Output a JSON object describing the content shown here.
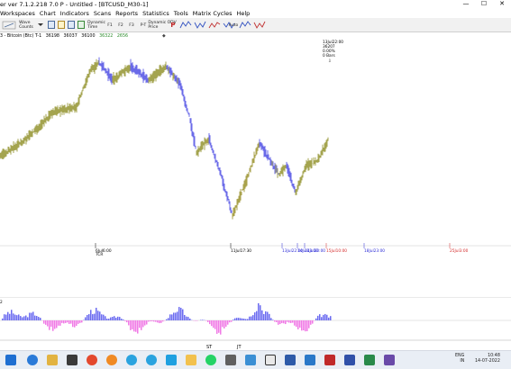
{
  "window": {
    "title": "er ver 7.1.2.218 7.0 P - Untitled - [BTCUSD_M30-1]",
    "min_glyph": "—",
    "max_glyph": "☐",
    "close_glyph": "✕"
  },
  "menu": [
    "Workspaces",
    "Chart",
    "Indicators",
    "Scans",
    "Reports",
    "Statistics",
    "Tools",
    "Matrix Cycles",
    "Help"
  ],
  "toolbar": {
    "wave_counts_label": "Wave\nCounts",
    "dynamic_time_label": "Dynamic\nTime",
    "f1": "F1",
    "f2": "F2",
    "f3": "F3",
    "pt": "P-T",
    "dynamic_price_label": "Dynamic ODV\nPrice",
    "auto": "Auto"
  },
  "quote_bar": {
    "ticker": "3 - Bitcoin (Btc) T-1",
    "values": [
      "36198",
      "36037",
      "36100",
      "36322",
      "2656"
    ]
  },
  "chart": {
    "price_box": [
      "13Jul22:00",
      "36207",
      "0.00%",
      "0 Bars"
    ],
    "time_labels": [
      {
        "text": "6Jul6:00",
        "sub": "TCR",
        "color": "#000000"
      },
      {
        "text": "11Jul17:30",
        "sub": "",
        "color": "#000000"
      },
      {
        "text": "13Jul22:00",
        "sub": "",
        "color": "#2b2bd6"
      },
      {
        "text": "14Jul13:00",
        "sub": "",
        "color": "#2b2bd6"
      },
      {
        "text": "14Jul20:00",
        "sub": "",
        "color": "#2b2bd6"
      },
      {
        "text": "15Jul10:00",
        "sub": "",
        "color": "#d42b2b"
      },
      {
        "text": "18Jul23:00",
        "sub": "",
        "color": "#2b2bd6"
      },
      {
        "text": "25Jul3:00",
        "sub": "",
        "color": "#d42b2b"
      }
    ],
    "indicator_scale": "2",
    "bottom_markers": [
      "ST",
      "JT"
    ],
    "series_up_color": "#9a9a3c",
    "series_down_color": "#5a5ae6"
  },
  "taskbar": {
    "tray_lang": "ENG\nIN",
    "tray_time": "10:48\n14-07-2022"
  }
}
